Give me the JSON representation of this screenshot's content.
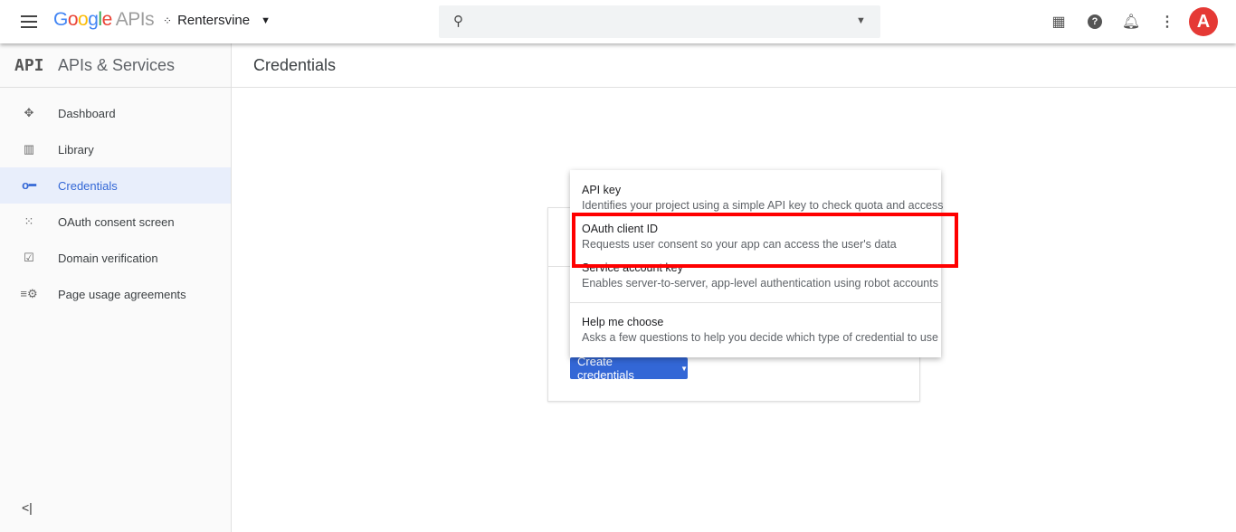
{
  "header": {
    "logo_google": "Google",
    "logo_apis": "APIs",
    "project": "Rentersvine",
    "search_placeholder": "",
    "avatar_letter": "A"
  },
  "sidebar": {
    "badge": "API",
    "title": "APIs & Services",
    "items": [
      {
        "label": "Dashboard",
        "icon": "dashboard-icon"
      },
      {
        "label": "Library",
        "icon": "library-icon"
      },
      {
        "label": "Credentials",
        "icon": "key-icon",
        "active": true
      },
      {
        "label": "OAuth consent screen",
        "icon": "consent-icon"
      },
      {
        "label": "Domain verification",
        "icon": "checkbox-icon"
      },
      {
        "label": "Page usage agreements",
        "icon": "settings-list-icon"
      }
    ],
    "collapse": "<|"
  },
  "main": {
    "title": "Credentials",
    "create_button": "Create credentials"
  },
  "dropdown": {
    "options": [
      {
        "title": "API key",
        "desc": "Identifies your project using a simple API key to check quota and access"
      },
      {
        "title": "OAuth client ID",
        "desc": "Requests user consent so your app can access the user's data"
      },
      {
        "title": "Service account key",
        "desc": "Enables server-to-server, app-level authentication using robot accounts"
      },
      {
        "title": "Help me choose",
        "desc": "Asks a few questions to help you decide which type of credential to use"
      }
    ]
  },
  "colors": {
    "accent": "#3367d6",
    "highlight": "#ff0000"
  }
}
